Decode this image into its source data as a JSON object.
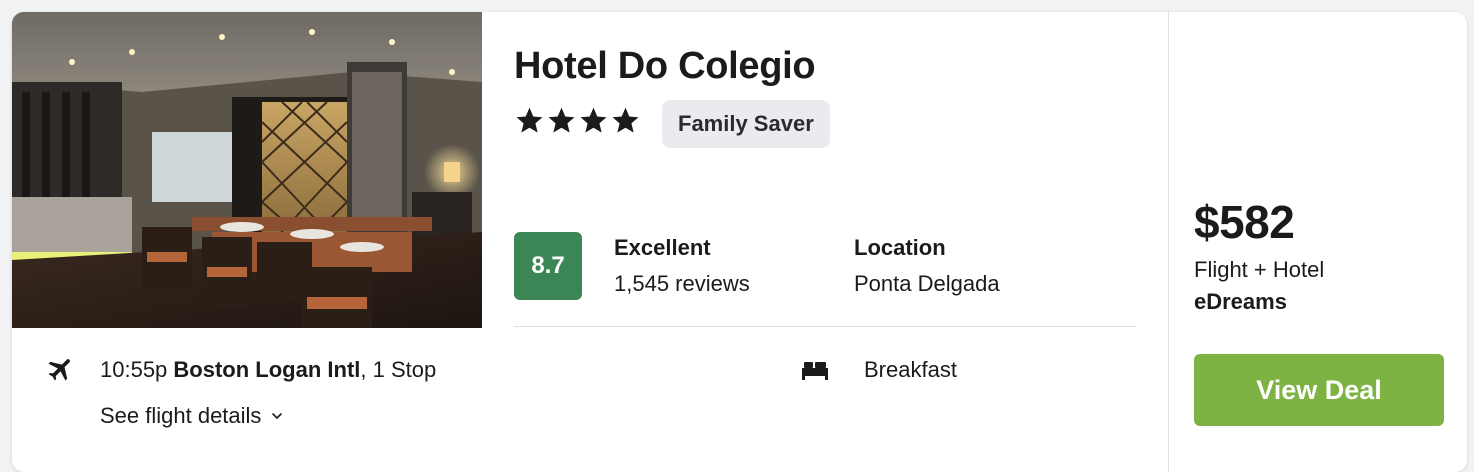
{
  "hotel": {
    "name": "Hotel Do Colegio",
    "star_rating": 4,
    "badge": "Family Saver"
  },
  "rating": {
    "score": "8.7",
    "label": "Excellent",
    "reviews": "1,545 reviews",
    "score_color": "#3b8654"
  },
  "location": {
    "label": "Location",
    "value": "Ponta Delgada"
  },
  "flight": {
    "icon": "airplane-icon",
    "time": "10:55p",
    "airport": "Boston Logan Intl",
    "stops": ", 1 Stop",
    "details_link": "See flight details"
  },
  "amenities": [
    {
      "icon": "bed-icon",
      "label": "Breakfast"
    }
  ],
  "deal": {
    "price": "$582",
    "package": "Flight + Hotel",
    "provider": "eDreams",
    "button_label": "View Deal",
    "button_color": "#7db342"
  }
}
